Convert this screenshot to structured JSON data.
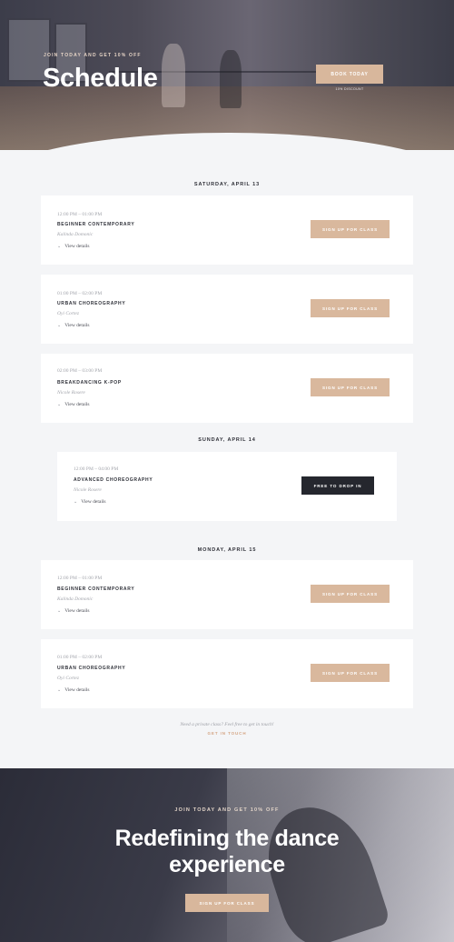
{
  "hero": {
    "eyebrow": "JOIN TODAY AND GET 10% OFF",
    "title": "Schedule",
    "book_button": "BOOK TODAY",
    "fine_print": "10% DISCOUNT"
  },
  "days": [
    {
      "heading": "SATURDAY, APRIL 13",
      "classes": [
        {
          "time": "12:00 PM – 01:00 PM",
          "title": "BEGINNER CONTEMPORARY",
          "teacher": "Kalinda Domonic",
          "details": "View details",
          "cta": "SIGN UP FOR CLASS"
        },
        {
          "time": "01:00 PM – 02:00 PM",
          "title": "URBAN CHOREOGRAPHY",
          "teacher": "Oyi Cortez",
          "details": "View details",
          "cta": "SIGN UP FOR CLASS"
        },
        {
          "time": "02:00 PM – 03:00 PM",
          "title": "BREAKDANCING K-POP",
          "teacher": "Nicole Rosere",
          "details": "View details",
          "cta": "SIGN UP FOR CLASS"
        }
      ]
    },
    {
      "heading": "SUNDAY, APRIL 14",
      "classes": [
        {
          "time": "12:00 PM – 04:00 PM",
          "title": "ADVANCED CHOREOGRAPHY",
          "teacher": "Nicole Rosere",
          "details": "View details",
          "cta": "FREE TO DROP IN"
        }
      ]
    },
    {
      "heading": "MONDAY, APRIL 15",
      "classes": [
        {
          "time": "12:00 PM – 01:00 PM",
          "title": "BEGINNER CONTEMPORARY",
          "teacher": "Kalinda Domonic",
          "details": "View details",
          "cta": "SIGN UP FOR CLASS"
        },
        {
          "time": "01:00 PM – 02:00 PM",
          "title": "URBAN CHOREOGRAPHY",
          "teacher": "Oyi Cortez",
          "details": "View details",
          "cta": "SIGN UP FOR CLASS"
        }
      ]
    }
  ],
  "private_note": "Need a private class? Feel free to get in touch!",
  "get_in_touch": "GET IN TOUCH",
  "footer": {
    "eyebrow": "JOIN TODAY AND GET 10% OFF",
    "headline_line1": "Redefining the dance",
    "headline_line2": "experience",
    "signup_button": "SIGN UP FOR CLASS"
  },
  "icons": {
    "details_toggle": "chevron-down-icon"
  },
  "colors": {
    "accent": "#d8b79c",
    "dark_button": "#25272e",
    "link": "#d4a584",
    "page_bg": "#f4f5f7"
  }
}
